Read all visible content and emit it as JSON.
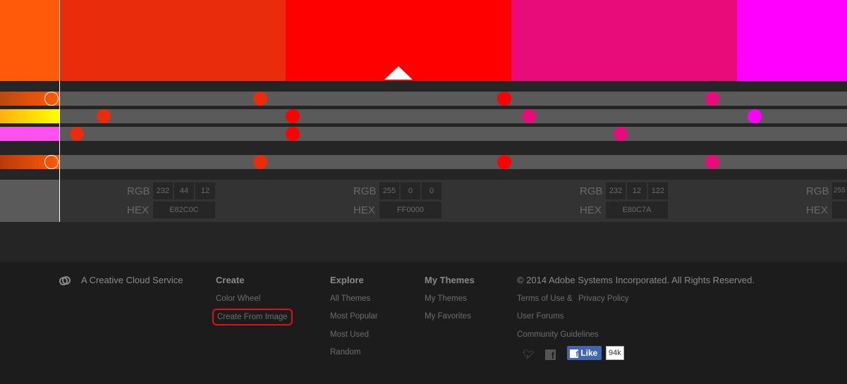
{
  "swatches": [
    {
      "hex": "#FF5A0A"
    },
    {
      "hex": "#E82C0C"
    },
    {
      "hex": "#FF0000"
    },
    {
      "hex": "#E80C7A"
    },
    {
      "hex": "#FF00FF"
    }
  ],
  "panels": [
    {
      "rgb_label": "RGB",
      "hex_label": "HEX",
      "r": "232",
      "g": "44",
      "b": "12",
      "hex": "E82C0C"
    },
    {
      "rgb_label": "RGB",
      "hex_label": "HEX",
      "r": "255",
      "g": "0",
      "b": "0",
      "hex": "FF0000"
    },
    {
      "rgb_label": "RGB",
      "hex_label": "HEX",
      "r": "232",
      "g": "12",
      "b": "122",
      "hex": "E80C7A"
    },
    {
      "rgb_label": "RGB",
      "hex_label": "HEX",
      "r": "255",
      "g": "",
      "b": "",
      "hex": ""
    }
  ],
  "footer": {
    "brand": "A Creative Cloud Service",
    "create": {
      "title": "Create",
      "items": [
        "Color Wheel",
        "Create From Image"
      ]
    },
    "explore": {
      "title": "Explore",
      "items": [
        "All Themes",
        "Most Popular",
        "Most Used",
        "Random"
      ]
    },
    "mythemes": {
      "title": "My Themes",
      "items": [
        "My Themes",
        "My Favorites"
      ]
    },
    "copyright": "© 2014 Adobe Systems Incorporated. All Rights Reserved.",
    "terms": "Terms of Use",
    "amp": "&",
    "privacy": "Privacy Policy",
    "forums": "User Forums",
    "guidelines": "Community Guidelines",
    "like_label": "Like",
    "like_count": "94k"
  }
}
